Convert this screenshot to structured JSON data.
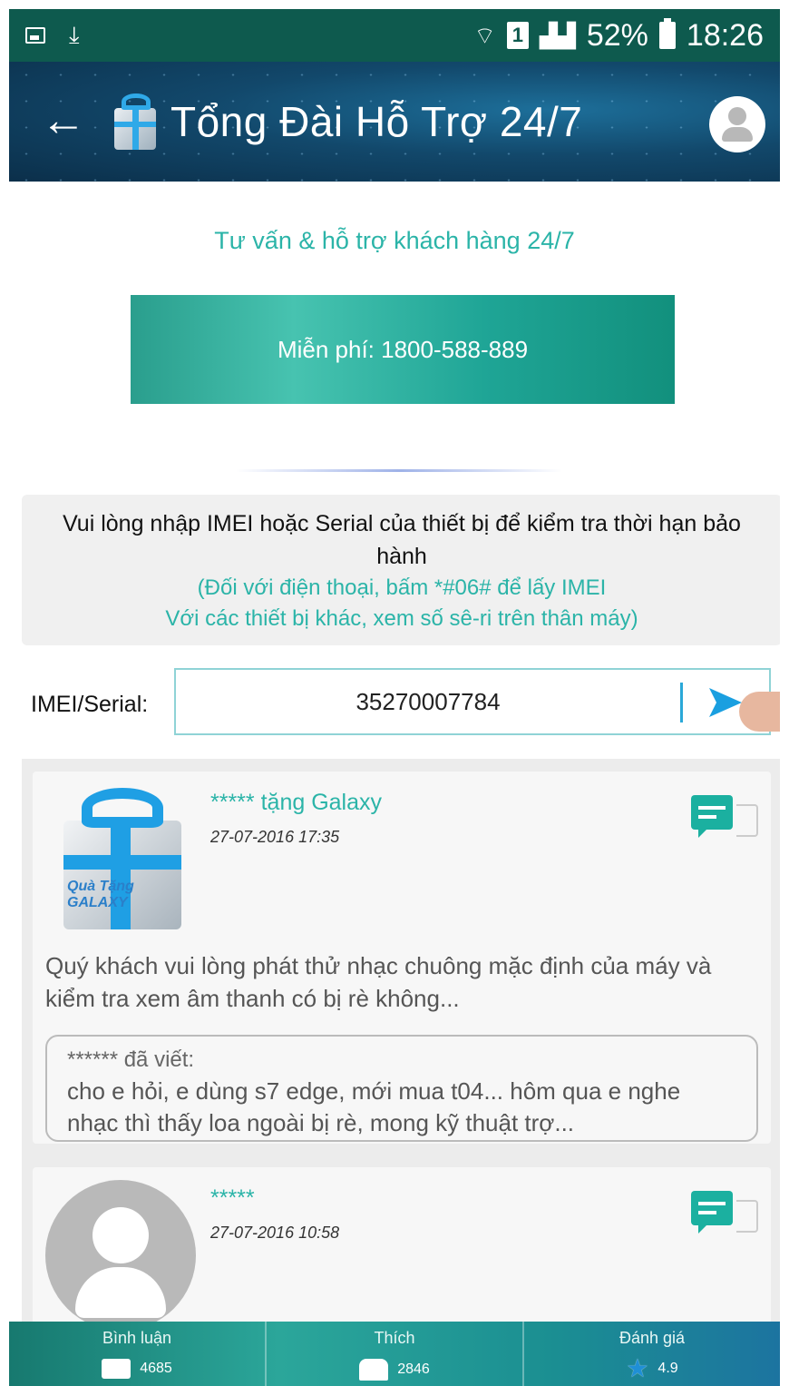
{
  "status_bar": {
    "battery": "52%",
    "time": "18:26",
    "sim": "1"
  },
  "header": {
    "title": "Tổng Đài Hỗ Trợ 24/7"
  },
  "intro": {
    "tagline": "Tư vấn & hỗ trợ khách hàng 24/7",
    "hotline": "Miễn phí: 1800-588-889"
  },
  "info": {
    "main": "Vui lòng nhập IMEI hoặc Serial của thiết bị để kiểm tra thời hạn bảo hành",
    "note1": "(Đối với điện thoại, bấm *#06# để lấy IMEI",
    "note2": "Với các thiết bị khác, xem số sê-ri trên thân máy)"
  },
  "imei": {
    "label": "IMEI/Serial:",
    "value": "35270007784"
  },
  "feed": [
    {
      "name": "***** tặng Galaxy",
      "date": "27-07-2016 17:35",
      "body": "Quý khách vui lòng phát thử nhạc chuông mặc định của máy và kiểm tra xem âm thanh có bị rè không...",
      "quote_author": "****** đã viết:",
      "quote_text": "cho e hỏi, e dùng s7 edge, mới mua t04... hôm qua e nghe nhạc thì thấy loa ngoài bị rè, mong kỹ thuật trợ..."
    },
    {
      "name": "*****",
      "date": "27-07-2016 10:58"
    }
  ],
  "bottom_bar": {
    "items": [
      {
        "label": "Bình luận",
        "value": "4685",
        "icon": "comment-icon"
      },
      {
        "label": "Thích",
        "value": "2846",
        "icon": "like-icon"
      },
      {
        "label": "Đánh giá",
        "value": "4.9",
        "icon": "star-icon"
      }
    ]
  },
  "colors": {
    "accent": "#2bb4a8",
    "header_bg": "#12486b",
    "status_bar_bg": "#0e5a4e"
  }
}
